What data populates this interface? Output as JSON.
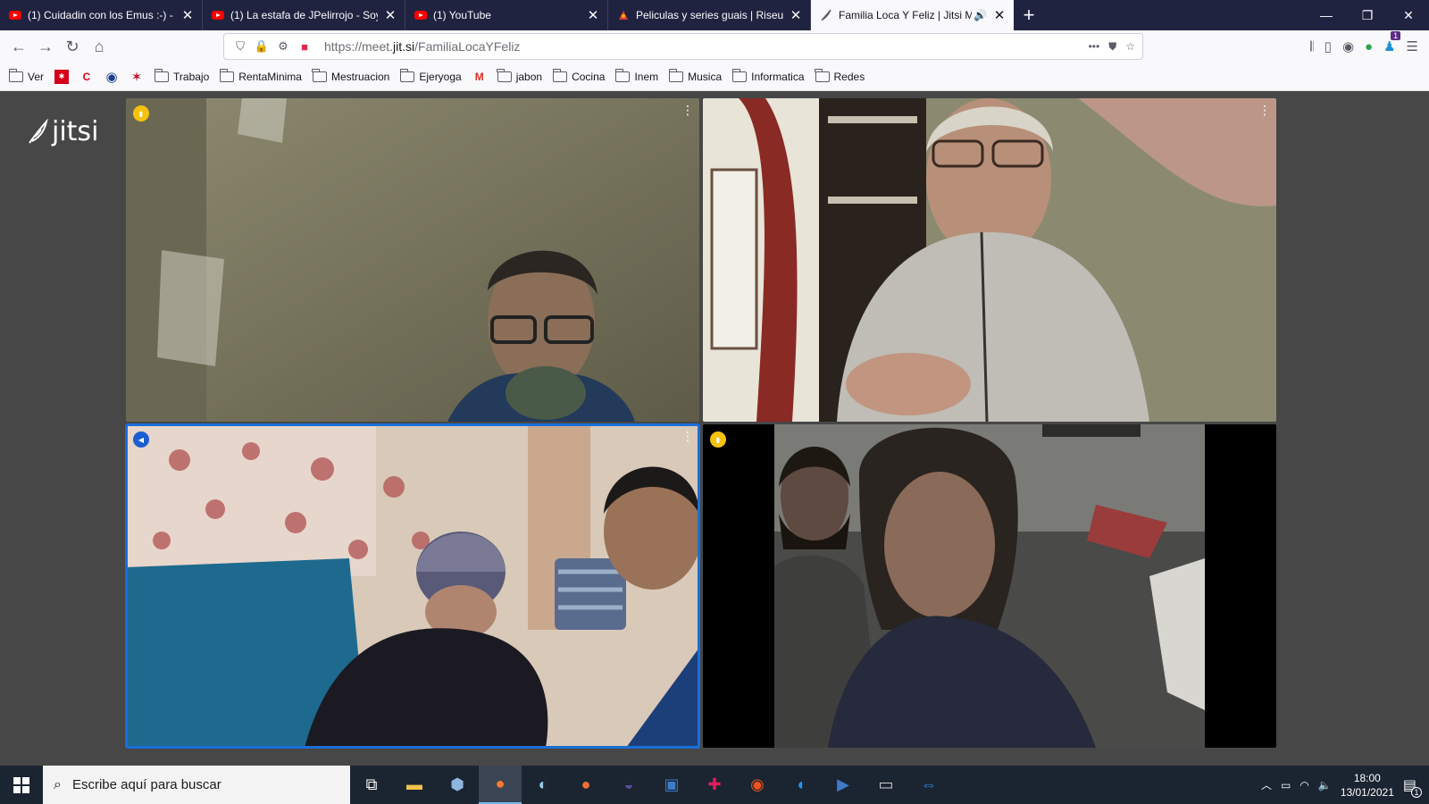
{
  "browser": {
    "tabs": [
      {
        "title": "(1) Cuidadin con los Emus :-) -",
        "icon": "youtube-icon"
      },
      {
        "title": "(1) La estafa de JPelirrojo - Soy",
        "icon": "youtube-icon"
      },
      {
        "title": "(1) YouTube",
        "icon": "youtube-icon"
      },
      {
        "title": "Peliculas y series guais | Riseup",
        "icon": "riseup-icon"
      },
      {
        "title": "Familia Loca Y Feliz | Jitsi Meet",
        "icon": "jitsi-feather-icon",
        "active": true
      }
    ],
    "url_prefix": "https://meet.",
    "url_host": "jit.si",
    "url_path": "/FamiliaLocaYFeliz",
    "badge_count": "1"
  },
  "bookmarks": [
    {
      "label": "Ver",
      "type": "folder"
    },
    {
      "label": "",
      "type": "icon",
      "icon": "madrid-icon"
    },
    {
      "label": "",
      "type": "icon",
      "icon": "c-icon"
    },
    {
      "label": "",
      "type": "icon",
      "icon": "circle-icon"
    },
    {
      "label": "",
      "type": "icon",
      "icon": "star-icon"
    },
    {
      "label": "Trabajo",
      "type": "folder"
    },
    {
      "label": "RentaMinima",
      "type": "folder"
    },
    {
      "label": "Mestruacion",
      "type": "folder"
    },
    {
      "label": "Ejeryoga",
      "type": "folder"
    },
    {
      "label": "",
      "type": "icon",
      "icon": "gmail-icon"
    },
    {
      "label": "jabon",
      "type": "folder"
    },
    {
      "label": "Cocina",
      "type": "folder"
    },
    {
      "label": "Inem",
      "type": "folder"
    },
    {
      "label": "Musica",
      "type": "folder"
    },
    {
      "label": "Informatica",
      "type": "folder"
    },
    {
      "label": "Redes",
      "type": "folder"
    }
  ],
  "jitsi": {
    "logo_text": "jitsi",
    "tiles": [
      {
        "name": "video-tile-top-left",
        "indicator": "connection",
        "scene": "man in glasses in a beige room"
      },
      {
        "name": "video-tile-top-right",
        "indicator": "none",
        "scene": "older woman in grey jacket"
      },
      {
        "name": "video-tile-bottom-left",
        "indicator": "speaker",
        "scene": "children in a floral-wallpaper room"
      },
      {
        "name": "video-tile-bottom-right",
        "indicator": "connection",
        "scene": "woman and man in a dim room"
      }
    ]
  },
  "taskbar": {
    "search_placeholder": "Escribe aquí para buscar",
    "time": "18:00",
    "date": "13/01/2021",
    "notification_count": "1"
  },
  "colors": {
    "tabstrip": "#202340",
    "stage": "#474747",
    "taskbar": "#1b2431",
    "indicator_yellow": "#f5c20d",
    "active_speaker": "#1a6fd8"
  }
}
